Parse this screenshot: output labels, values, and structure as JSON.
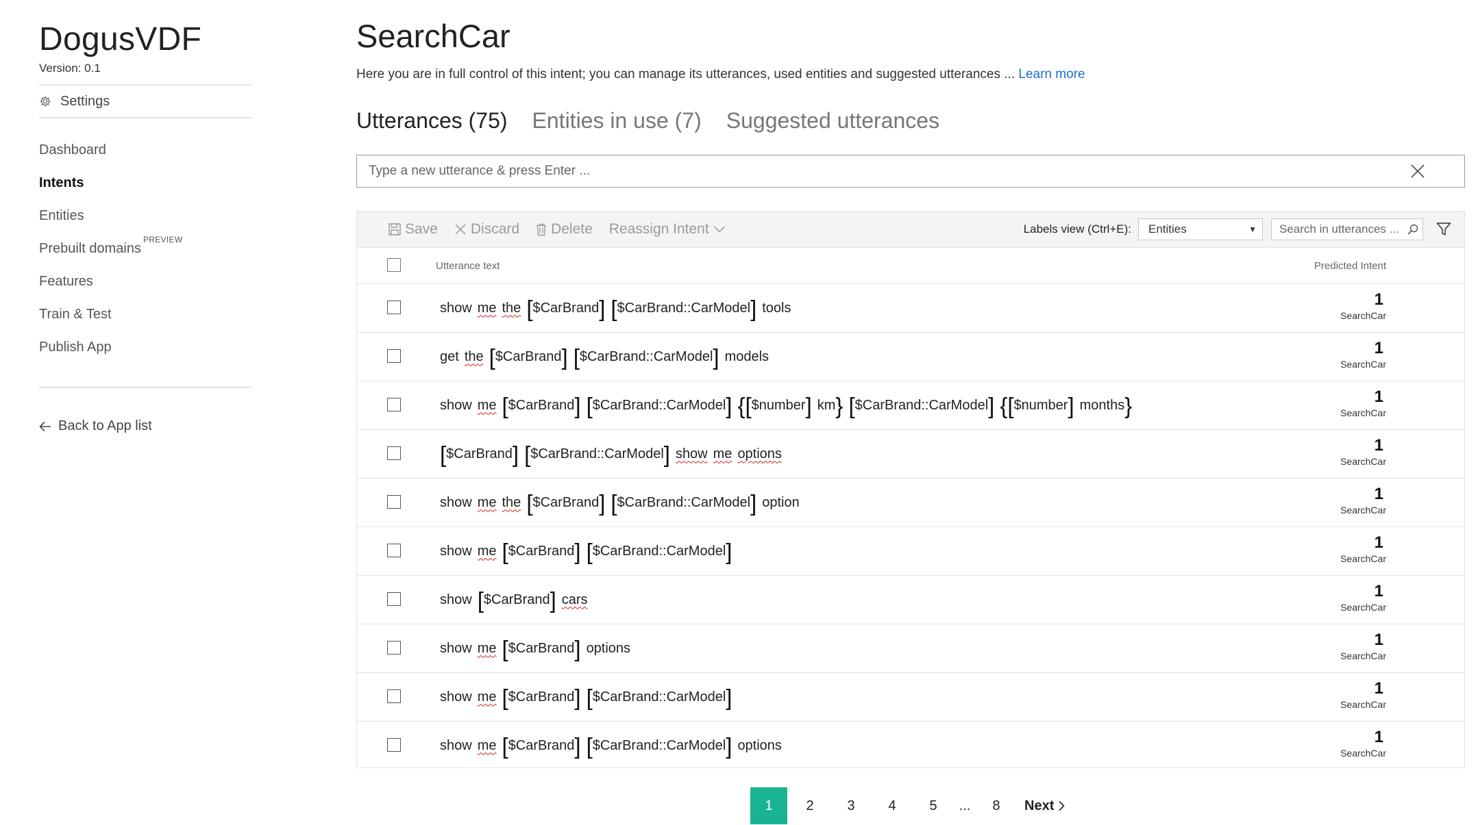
{
  "sidebar": {
    "app_name": "DogusVDF",
    "version": "Version:  0.1",
    "settings_label": "Settings",
    "nav": [
      {
        "label": "Dashboard"
      },
      {
        "label": "Intents"
      },
      {
        "label": "Entities"
      },
      {
        "label": "Prebuilt domains",
        "badge": "PREVIEW"
      },
      {
        "label": "Features"
      },
      {
        "label": "Train & Test"
      },
      {
        "label": "Publish App"
      }
    ],
    "back_label": "Back to App list"
  },
  "main": {
    "title": "SearchCar",
    "description": "Here you are in full control of this intent; you can manage its utterances, used entities and suggested utterances ... ",
    "learn_more": "Learn more",
    "tabs": [
      {
        "label": "Utterances (75)"
      },
      {
        "label": "Entities in use (7)"
      },
      {
        "label": "Suggested utterances"
      }
    ],
    "utterance_input": {
      "placeholder": "Type a new utterance & press Enter ..."
    }
  },
  "toolbar": {
    "save": "Save",
    "discard": "Discard",
    "delete": "Delete",
    "reassign": "Reassign Intent",
    "labels_view": "Labels view (Ctrl+E):",
    "labels_view_value": "Entities",
    "search_placeholder": "Search in utterances ..."
  },
  "table": {
    "col_utterance": "Utterance text",
    "col_predicted": "Predicted Intent",
    "rows": [
      {
        "tokens": [
          {
            "t": "w",
            "v": "show"
          },
          {
            "t": "ws",
            "v": "me"
          },
          {
            "t": "ws",
            "v": "the"
          },
          {
            "t": "e",
            "v": "$CarBrand"
          },
          {
            "t": "e",
            "v": "$CarBrand::CarModel"
          },
          {
            "t": "w",
            "v": "tools"
          }
        ],
        "score": "1",
        "intent": "SearchCar"
      },
      {
        "tokens": [
          {
            "t": "w",
            "v": "get"
          },
          {
            "t": "ws",
            "v": "the"
          },
          {
            "t": "e",
            "v": "$CarBrand"
          },
          {
            "t": "e",
            "v": "$CarBrand::CarModel"
          },
          {
            "t": "w",
            "v": "models"
          }
        ],
        "score": "1",
        "intent": "SearchCar"
      },
      {
        "tokens": [
          {
            "t": "w",
            "v": "show"
          },
          {
            "t": "ws",
            "v": "me"
          },
          {
            "t": "e",
            "v": "$CarBrand"
          },
          {
            "t": "e",
            "v": "$CarBrand::CarModel"
          },
          {
            "t": "c",
            "v": [
              {
                "t": "e",
                "v": "$number"
              },
              {
                "t": "w",
                "v": "km"
              }
            ]
          },
          {
            "t": "e",
            "v": "$CarBrand::CarModel"
          },
          {
            "t": "c",
            "v": [
              {
                "t": "e",
                "v": "$number"
              },
              {
                "t": "w",
                "v": "months"
              }
            ]
          }
        ],
        "score": "1",
        "intent": "SearchCar"
      },
      {
        "tokens": [
          {
            "t": "e",
            "v": "$CarBrand"
          },
          {
            "t": "e",
            "v": "$CarBrand::CarModel"
          },
          {
            "t": "ws",
            "v": "show"
          },
          {
            "t": "ws",
            "v": "me"
          },
          {
            "t": "ws",
            "v": "options"
          }
        ],
        "score": "1",
        "intent": "SearchCar"
      },
      {
        "tokens": [
          {
            "t": "w",
            "v": "show"
          },
          {
            "t": "ws",
            "v": "me"
          },
          {
            "t": "ws",
            "v": "the"
          },
          {
            "t": "e",
            "v": "$CarBrand"
          },
          {
            "t": "e",
            "v": "$CarBrand::CarModel"
          },
          {
            "t": "w",
            "v": "option"
          }
        ],
        "score": "1",
        "intent": "SearchCar"
      },
      {
        "tokens": [
          {
            "t": "w",
            "v": "show"
          },
          {
            "t": "ws",
            "v": "me"
          },
          {
            "t": "e",
            "v": "$CarBrand"
          },
          {
            "t": "e",
            "v": "$CarBrand::CarModel"
          }
        ],
        "score": "1",
        "intent": "SearchCar"
      },
      {
        "tokens": [
          {
            "t": "w",
            "v": "show"
          },
          {
            "t": "e",
            "v": "$CarBrand"
          },
          {
            "t": "ws",
            "v": "cars"
          }
        ],
        "score": "1",
        "intent": "SearchCar"
      },
      {
        "tokens": [
          {
            "t": "w",
            "v": "show"
          },
          {
            "t": "ws",
            "v": "me"
          },
          {
            "t": "e",
            "v": "$CarBrand"
          },
          {
            "t": "w",
            "v": "options"
          }
        ],
        "score": "1",
        "intent": "SearchCar"
      },
      {
        "tokens": [
          {
            "t": "w",
            "v": "show"
          },
          {
            "t": "ws",
            "v": "me"
          },
          {
            "t": "e",
            "v": "$CarBrand"
          },
          {
            "t": "e",
            "v": "$CarBrand::CarModel"
          }
        ],
        "score": "1",
        "intent": "SearchCar"
      },
      {
        "tokens": [
          {
            "t": "w",
            "v": "show"
          },
          {
            "t": "ws",
            "v": "me"
          },
          {
            "t": "e",
            "v": "$CarBrand"
          },
          {
            "t": "e",
            "v": "$CarBrand::CarModel"
          },
          {
            "t": "w",
            "v": "options"
          }
        ],
        "score": "1",
        "intent": "SearchCar"
      }
    ]
  },
  "pagination": {
    "pages": [
      "1",
      "2",
      "3",
      "4",
      "5"
    ],
    "ellipsis": "...",
    "last": "8",
    "current": "1",
    "next": "Next"
  },
  "colors": {
    "accent": "#1ab394",
    "link": "#1a6fd4",
    "squiggle": "#d02020"
  }
}
